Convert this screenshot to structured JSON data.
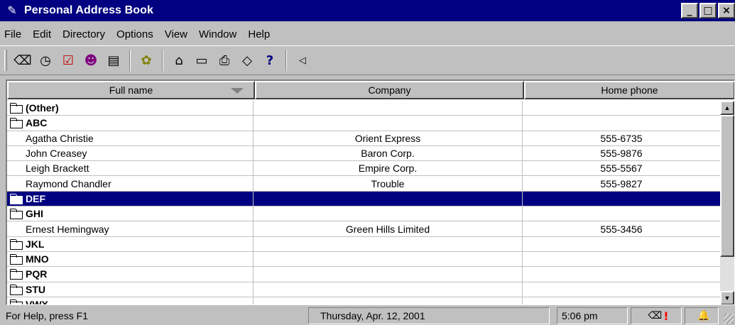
{
  "window": {
    "title": "Personal Address Book",
    "title_icon": "address-book-icon",
    "buttons": {
      "minimize": "_",
      "maximize": "□",
      "close": "×"
    }
  },
  "menu": [
    {
      "label": "File"
    },
    {
      "label": "Edit"
    },
    {
      "label": "Directory"
    },
    {
      "label": "Options"
    },
    {
      "label": "View"
    },
    {
      "label": "Window"
    },
    {
      "label": "Help"
    }
  ],
  "toolbar": {
    "buttons": [
      {
        "icon": "eraser-icon",
        "glyph": "⌫"
      },
      {
        "icon": "clock-icon",
        "glyph": "◷"
      },
      {
        "icon": "checkbox-icon",
        "glyph": "☑"
      },
      {
        "icon": "people-icon",
        "glyph": "☻"
      },
      {
        "icon": "address-card-icon",
        "glyph": "▤"
      },
      {
        "icon": "contacts-icon",
        "glyph": "✿"
      },
      {
        "icon": "open-folder-icon",
        "glyph": "⌂"
      },
      {
        "icon": "folder-icon",
        "glyph": "▭"
      },
      {
        "icon": "printer-icon",
        "glyph": "⎙"
      },
      {
        "icon": "tag-icon",
        "glyph": "◇"
      },
      {
        "icon": "help-icon",
        "glyph": "?"
      },
      {
        "icon": "arrow-left-icon",
        "glyph": "◁"
      }
    ]
  },
  "columns": {
    "name": "Full name",
    "company": "Company",
    "phone": "Home phone"
  },
  "rows": [
    {
      "type": "group",
      "name": "(Other)",
      "company": "",
      "phone": "",
      "expanded": false
    },
    {
      "type": "group",
      "name": "ABC",
      "company": "",
      "phone": "",
      "expanded": true
    },
    {
      "type": "entry",
      "name": "Agatha Christie",
      "company": "Orient Express",
      "phone": "555-6735"
    },
    {
      "type": "entry",
      "name": "John Creasey",
      "company": "Baron Corp.",
      "phone": "555-9876"
    },
    {
      "type": "entry",
      "name": "Leigh Brackett",
      "company": "Empire Corp.",
      "phone": "555-5567"
    },
    {
      "type": "entry",
      "name": "Raymond Chandler",
      "company": "Trouble",
      "phone": "555-9827"
    },
    {
      "type": "group",
      "name": "DEF",
      "company": "",
      "phone": "",
      "expanded": false,
      "selected": true
    },
    {
      "type": "group",
      "name": "GHI",
      "company": "",
      "phone": "",
      "expanded": true
    },
    {
      "type": "entry",
      "name": "Ernest Hemingway",
      "company": "Green Hills Limited",
      "phone": "555-3456"
    },
    {
      "type": "group",
      "name": "JKL",
      "company": "",
      "phone": "",
      "expanded": false
    },
    {
      "type": "group",
      "name": "MNO",
      "company": "",
      "phone": "",
      "expanded": false
    },
    {
      "type": "group",
      "name": "PQR",
      "company": "",
      "phone": "",
      "expanded": false
    },
    {
      "type": "group",
      "name": "STU",
      "company": "",
      "phone": "",
      "expanded": false
    },
    {
      "type": "group",
      "name": "VWX",
      "company": "",
      "phone": "",
      "expanded": true
    }
  ],
  "status": {
    "help": "For Help, press F1",
    "date": "Thursday, Apr. 12, 2001",
    "time": "5:06 pm",
    "alert_glyph": "!",
    "colors": {
      "selection": "#000080",
      "alert": "#ff0000"
    }
  }
}
